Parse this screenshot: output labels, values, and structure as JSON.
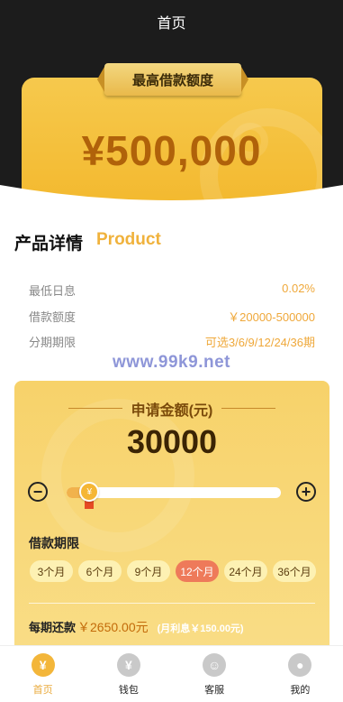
{
  "header": {
    "title": "首页"
  },
  "limit": {
    "label": "最高借款额度",
    "amount": "¥500,000"
  },
  "product": {
    "title": "产品详情",
    "subtitle": "Product",
    "rows": [
      {
        "key": "最低日息",
        "value": "0.02%"
      },
      {
        "key": "借款额度",
        "value": "￥20000-500000"
      },
      {
        "key": "分期期限",
        "value": "可选3/6/9/12/24/36期"
      }
    ]
  },
  "watermark": "www.99k9.net",
  "apply": {
    "title": "申请金额(元)",
    "amount": "30000",
    "slider_fraction": 0.06,
    "term_label": "借款期限",
    "terms": [
      "3个月",
      "6个月",
      "9个月",
      "12个月",
      "24个月",
      "36个月"
    ],
    "selected_term": "12个月",
    "repay_label": "每期还款",
    "repay_amount": "￥2650.00元",
    "interest": "(月利息￥150.00元)"
  },
  "tabs": [
    {
      "label": "首页",
      "icon": "yen-bag-icon",
      "active": true
    },
    {
      "label": "钱包",
      "icon": "wallet-icon",
      "active": false
    },
    {
      "label": "客服",
      "icon": "chat-icon",
      "active": false
    },
    {
      "label": "我的",
      "icon": "user-icon",
      "active": false
    }
  ],
  "colors": {
    "accent": "#f3b63a",
    "selected_term": "#ee7a5a",
    "dark_header": "#1c1c1c"
  }
}
